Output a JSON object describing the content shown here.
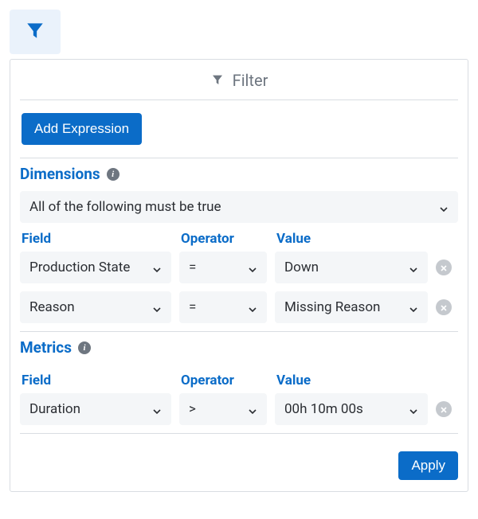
{
  "icons": {
    "filter": "filter-icon",
    "info": "i",
    "chevron_down": "chevron-down",
    "close_x": "x"
  },
  "tab": {
    "name": "filter-tab"
  },
  "header": {
    "title": "Filter"
  },
  "buttons": {
    "add_expression": "Add Expression",
    "apply": "Apply"
  },
  "dimensions": {
    "title": "Dimensions",
    "condition_label": "All of the following must be true",
    "columns": {
      "field": "Field",
      "operator": "Operator",
      "value": "Value"
    },
    "rows": [
      {
        "field": "Production State",
        "operator": "=",
        "value": "Down"
      },
      {
        "field": "Reason",
        "operator": "=",
        "value": "Missing Reason"
      }
    ]
  },
  "metrics": {
    "title": "Metrics",
    "columns": {
      "field": "Field",
      "operator": "Operator",
      "value": "Value"
    },
    "rows": [
      {
        "field": "Duration",
        "operator": ">",
        "value": "00h 10m 00s"
      }
    ]
  }
}
